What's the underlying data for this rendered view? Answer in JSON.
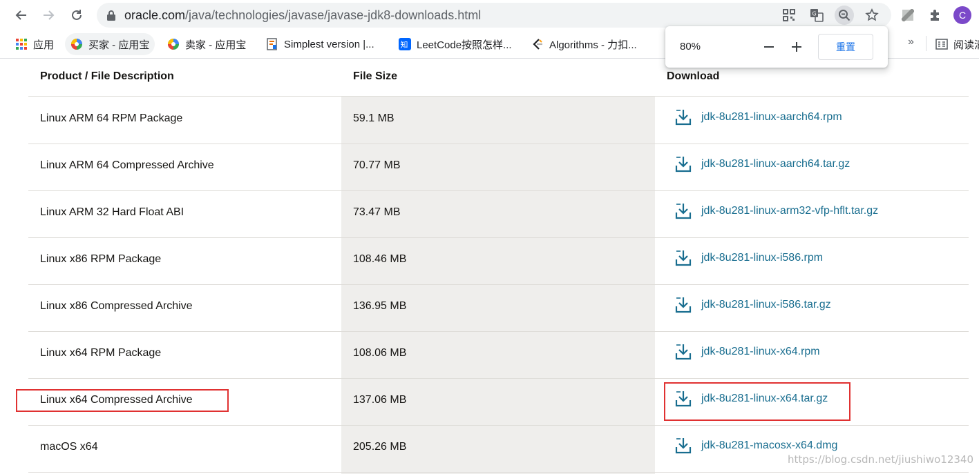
{
  "browser": {
    "url_host": "oracle.com",
    "url_path": "/java/technologies/javase/javase-jdk8-downloads.html",
    "avatar_letter": "C"
  },
  "bookmarks": [
    {
      "label": "应用",
      "icon": "apps-grid-icon"
    },
    {
      "label": "买家 - 应用宝",
      "icon": "yingyongbao-icon"
    },
    {
      "label": "卖家 - 应用宝",
      "icon": "yingyongbao-icon"
    },
    {
      "label": "Simplest version |...",
      "icon": "bookmark-page-icon"
    },
    {
      "label": "LeetCode按照怎样...",
      "icon": "zhihu-icon"
    },
    {
      "label": "Algorithms - 力扣...",
      "icon": "leetcode-icon"
    }
  ],
  "bookmarks_more": "»",
  "bookmarks_reading": "阅读清",
  "zoom": {
    "level": "80%",
    "reset_label": "重置",
    "minus": "−",
    "plus": "+"
  },
  "table": {
    "headers": [
      "Product / File Description",
      "File Size",
      "Download"
    ],
    "rows": [
      {
        "desc": "Linux ARM 64 RPM Package",
        "size": "59.1 MB",
        "file": "jdk-8u281-linux-aarch64.rpm"
      },
      {
        "desc": "Linux ARM 64 Compressed Archive",
        "size": "70.77 MB",
        "file": "jdk-8u281-linux-aarch64.tar.gz"
      },
      {
        "desc": "Linux ARM 32 Hard Float ABI",
        "size": "73.47 MB",
        "file": "jdk-8u281-linux-arm32-vfp-hflt.tar.gz"
      },
      {
        "desc": "Linux x86 RPM Package",
        "size": "108.46 MB",
        "file": "jdk-8u281-linux-i586.rpm"
      },
      {
        "desc": "Linux x86 Compressed Archive",
        "size": "136.95 MB",
        "file": "jdk-8u281-linux-i586.tar.gz"
      },
      {
        "desc": "Linux x64 RPM Package",
        "size": "108.06 MB",
        "file": "jdk-8u281-linux-x64.rpm"
      },
      {
        "desc": "Linux x64 Compressed Archive",
        "size": "137.06 MB",
        "file": "jdk-8u281-linux-x64.tar.gz"
      },
      {
        "desc": "macOS x64",
        "size": "205.26 MB",
        "file": "jdk-8u281-macosx-x64.dmg"
      }
    ]
  },
  "watermark": "https://blog.csdn.net/jiushiwo12340",
  "colors": {
    "link": "#186d8f",
    "highlight": "#e03131",
    "shaded_column": "#efeeec"
  }
}
